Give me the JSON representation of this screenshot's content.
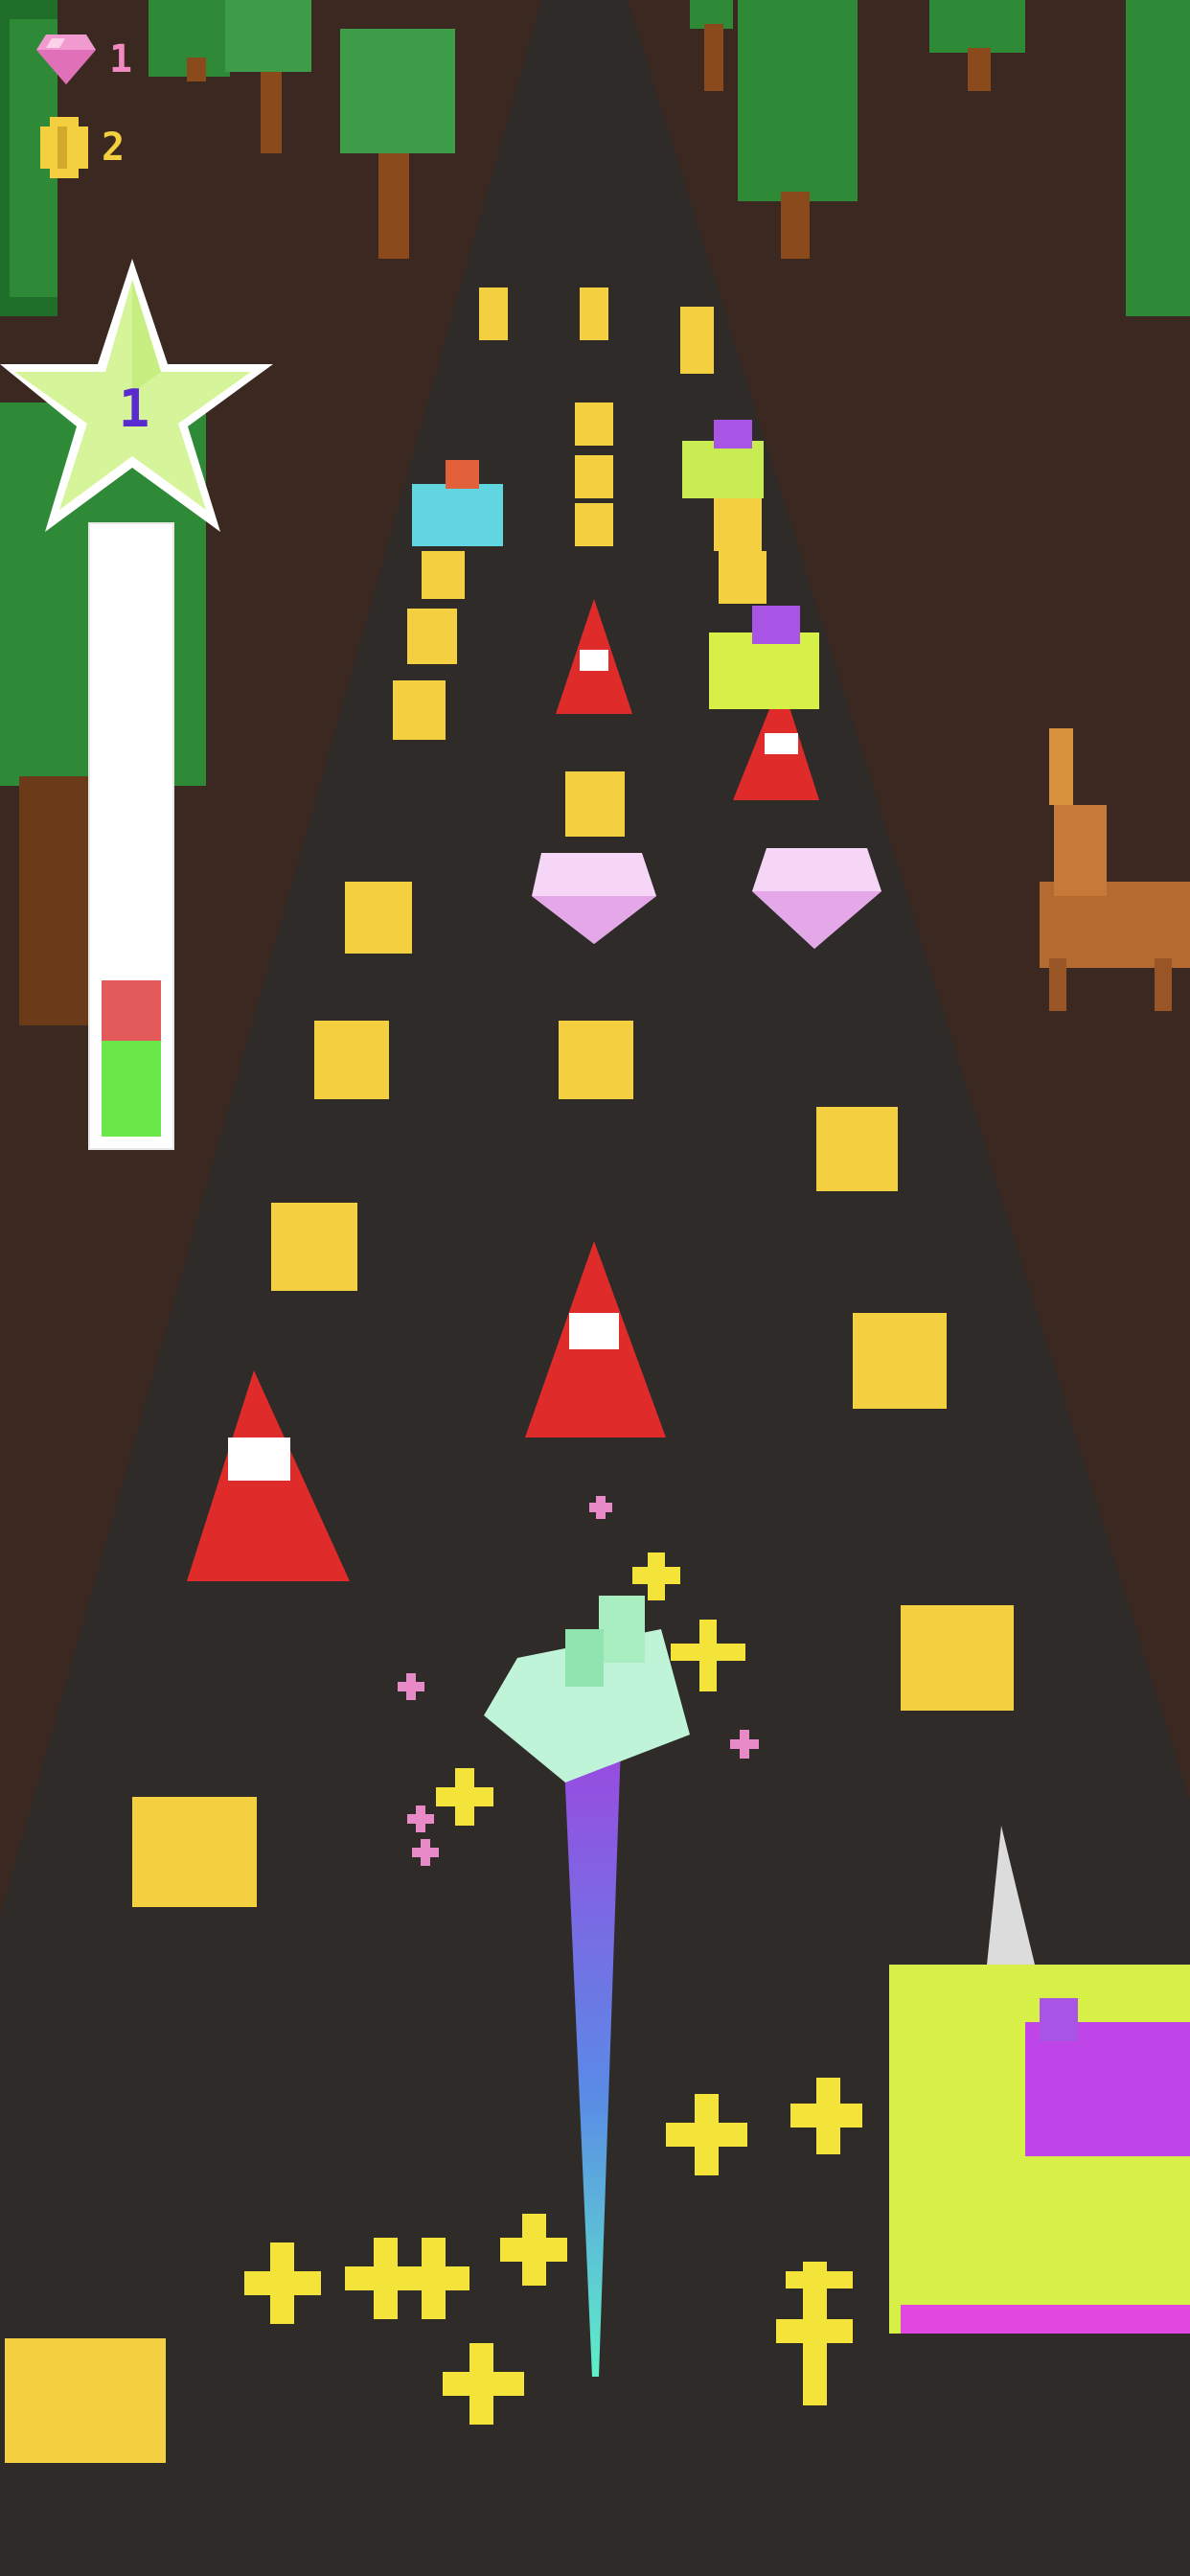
{
  "hud": {
    "gems": "1",
    "coins": "2",
    "level": "1"
  },
  "progress": {
    "green_fraction": 0.16,
    "red_fraction": 0.1
  },
  "icons": {
    "gem": "pink-diamond-icon",
    "coin": "gold-coin-icon",
    "level": "star-icon"
  },
  "colors": {
    "road": "#2f2b29",
    "ground": "#3b2820",
    "coin": "#f4d040",
    "cone": "#e02b2b",
    "gem": "#f6d6f6",
    "trail_top": "#9a4ae0",
    "trail_bottom": "#5ef0c8",
    "hud_text": "#f08ac0",
    "coin_text": "#f4d040"
  }
}
